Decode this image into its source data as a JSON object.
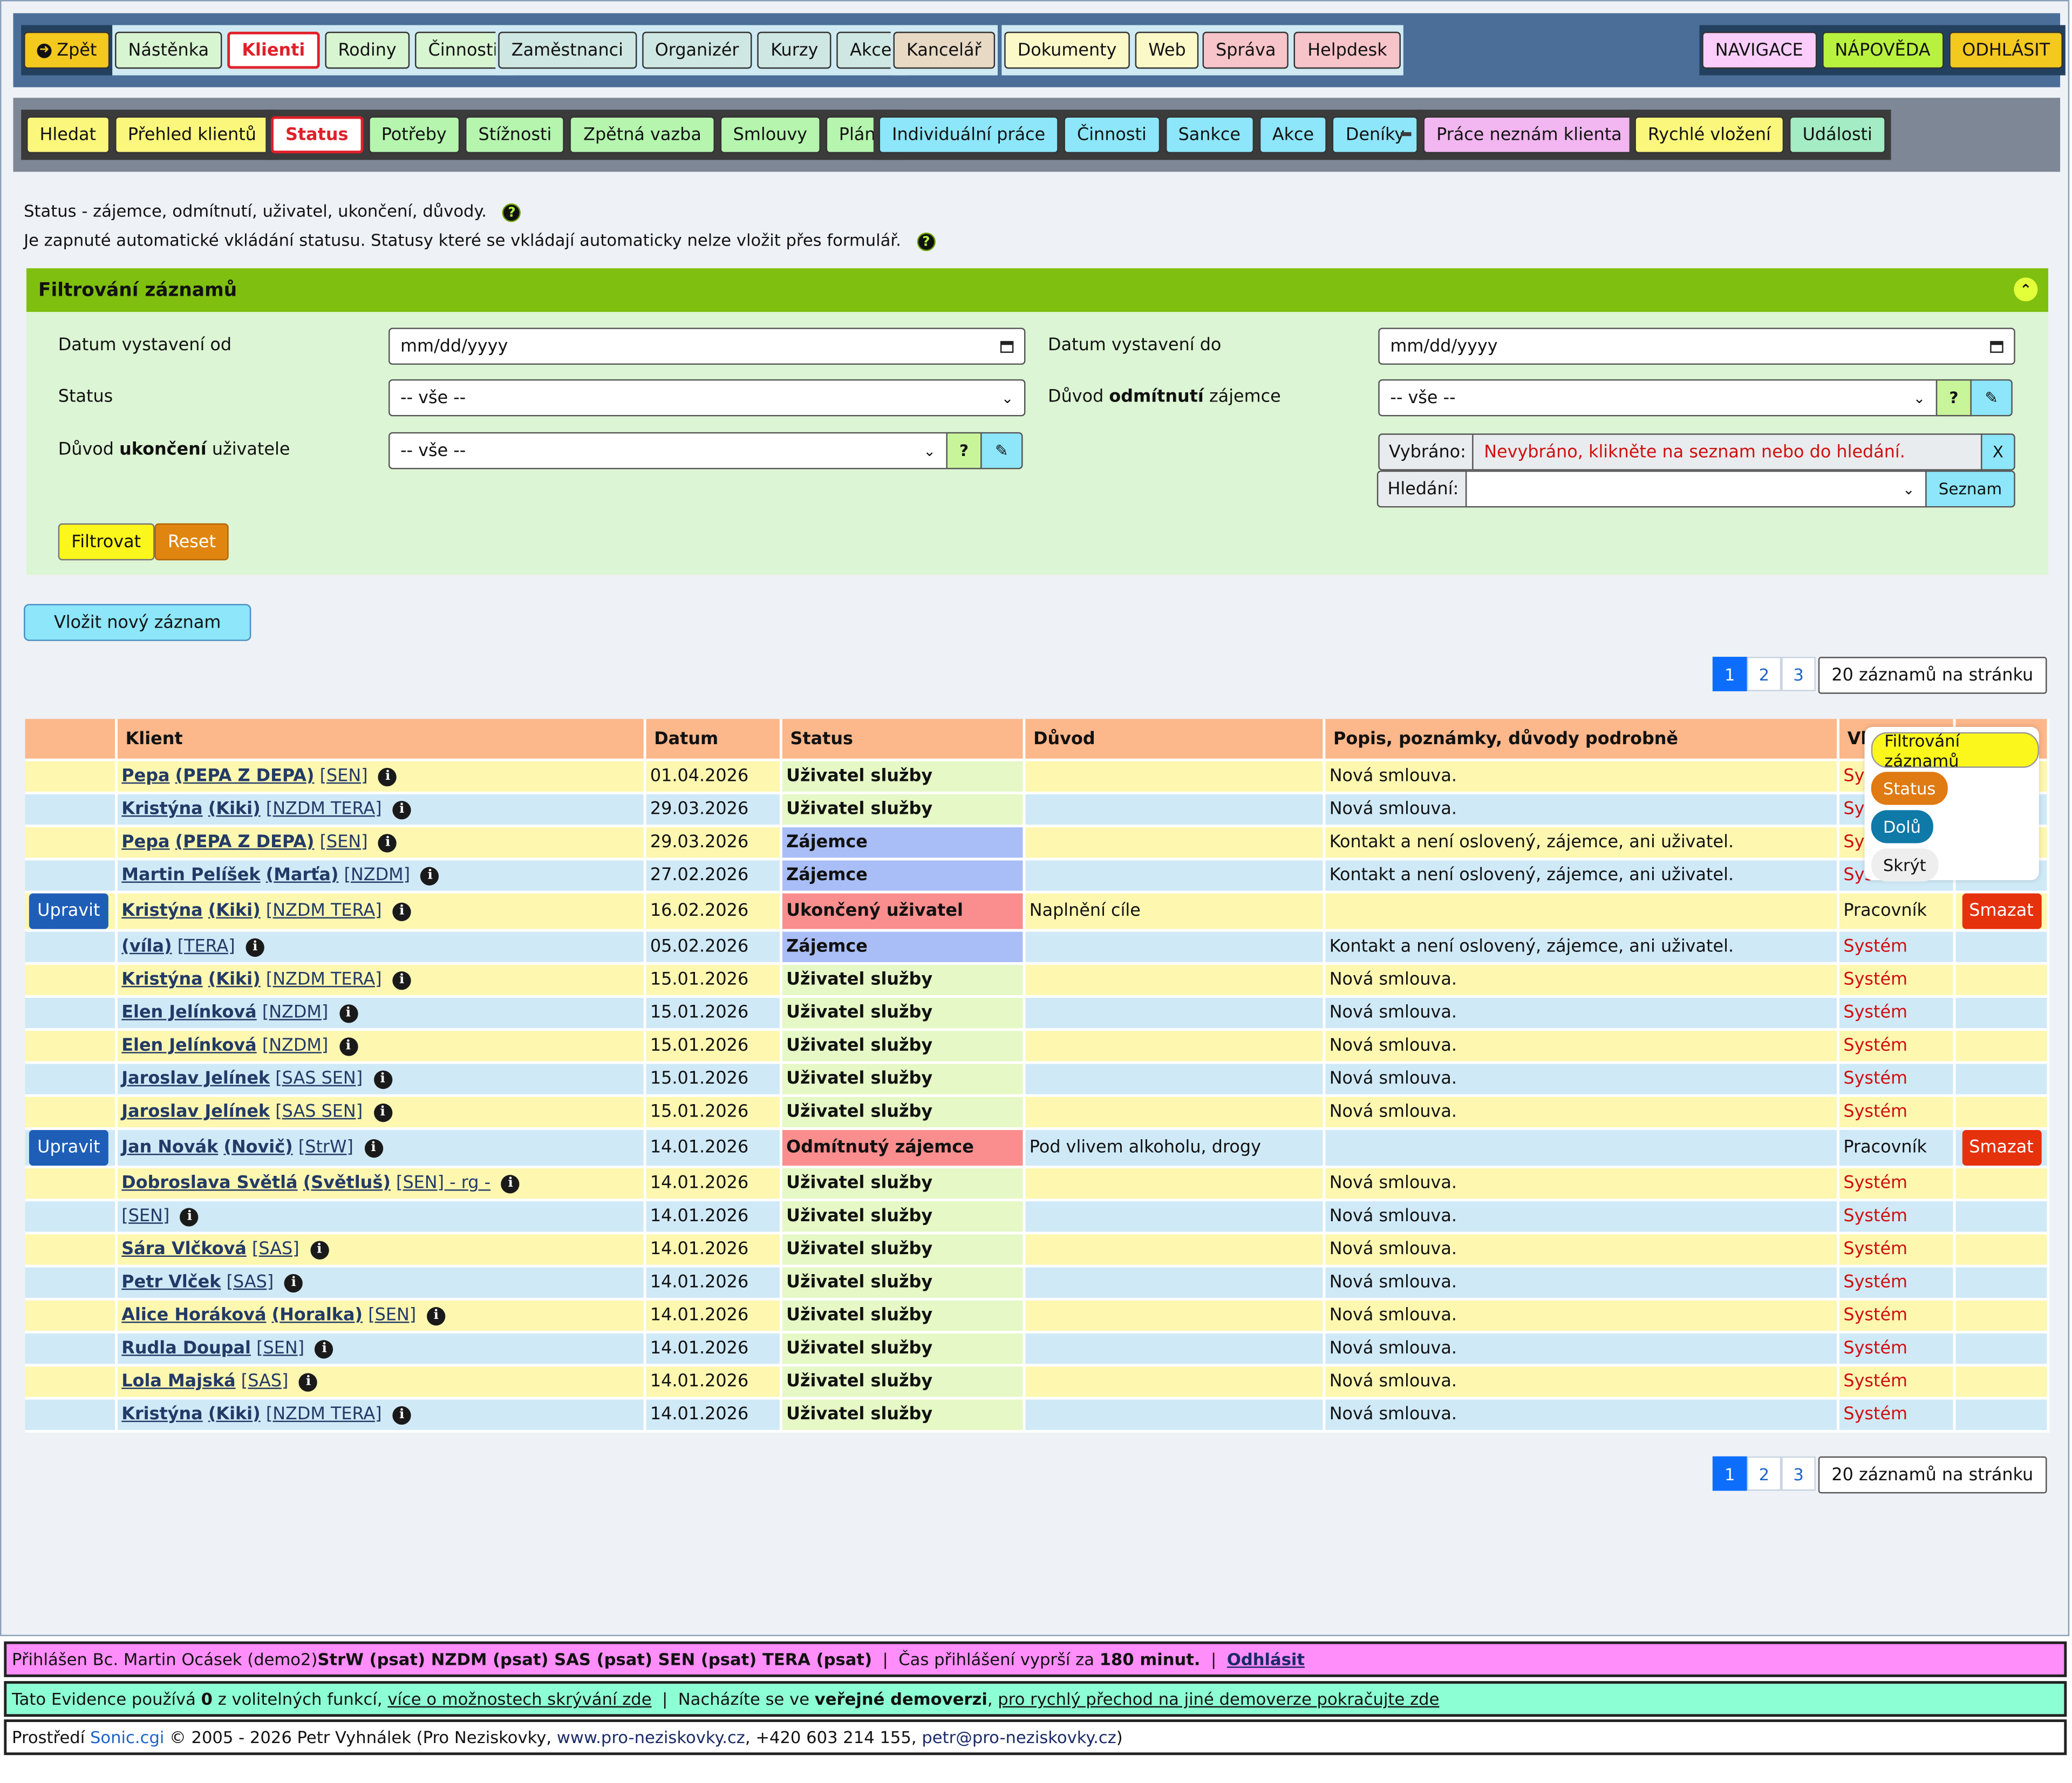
{
  "topnav": {
    "back": "Zpět",
    "items": [
      "Nástěnka",
      "Klienti",
      "Rodiny",
      "Činnosti",
      "Zaměstnanci",
      "Organizér",
      "Kurzy",
      "Akce",
      "Kancelář",
      "Dokumenty",
      "Web",
      "Správa",
      "Helpdesk"
    ],
    "right": [
      "NAVIGACE",
      "NÁPOVĚDA",
      "ODHLÁSIT"
    ]
  },
  "subnav": {
    "items": [
      "Hledat",
      "Přehled klientů",
      "Status",
      "Potřeby",
      "Stížnosti",
      "Zpětná vazba",
      "Smlouvy",
      "Plány",
      "Individuální práce",
      "Činnosti",
      "Sankce",
      "Akce",
      "Deníky",
      "Práce neznám klienta",
      "Rychlé vložení",
      "Události"
    ]
  },
  "intro": {
    "line1": "Status - zájemce, odmítnutí, uživatel, ukončení, důvody.",
    "line2": "Je zapnuté automatické vkládání statusu. Statusy které se vkládají automaticky nelze vložit přes formulář."
  },
  "filter": {
    "title": "Filtrování záznamů",
    "date_from_label": "Datum vystavení od",
    "date_to_label": "Datum vystavení do",
    "date_placeholder": "mm/dd/yyyy",
    "status_label": "Status",
    "reason_reject_pre": "Důvod ",
    "reason_reject_bold": "odmítnutí",
    "reason_reject_post": " zájemce",
    "reason_end_pre": "Důvod ",
    "reason_end_bold": "ukončení",
    "reason_end_post": " uživatele",
    "select_all": "-- vše --",
    "selected_label": "Vybráno:",
    "selected_value": "Nevybráno, klikněte na seznam nebo do hledání.",
    "search_label": "Hledání:",
    "list_button": "Seznam",
    "clear_button": "X",
    "question": "?",
    "filter_button": "Filtrovat",
    "reset_button": "Reset"
  },
  "new_record_button": "Vložit nový záznam",
  "pager": {
    "pages": [
      "1",
      "2",
      "3"
    ],
    "per_page": "20 záznamů na stránku"
  },
  "table": {
    "headers": [
      "",
      "Klient",
      "Datum",
      "Status",
      "Důvod",
      "Popis, poznámky, důvody podrobně",
      "Vl",
      ""
    ],
    "upravit": "Upravit",
    "smazat": "Smazat",
    "rows": [
      {
        "name": "Pepa",
        "nick": "PEPA Z DEPA",
        "tag": "[SEN]",
        "date": "01.04.2026",
        "status": "Uživatel služby",
        "st": "user",
        "reason": "",
        "desc": "Nová smlouva.",
        "by": "Sys",
        "act": false
      },
      {
        "name": "Kristýna",
        "nick": "Kiki",
        "tag": "[NZDM TERA]",
        "date": "29.03.2026",
        "status": "Uživatel služby",
        "st": "user",
        "reason": "",
        "desc": "Nová smlouva.",
        "by": "Sys",
        "act": false
      },
      {
        "name": "Pepa",
        "nick": "PEPA Z DEPA",
        "tag": "[SEN]",
        "date": "29.03.2026",
        "status": "Zájemce",
        "st": "zaj",
        "reason": "",
        "desc": "Kontakt a není oslovený, zájemce, ani uživatel.",
        "by": "Sys",
        "act": false
      },
      {
        "name": "Martin Pelíšek",
        "nick": "Marťa",
        "tag": "[NZDM]",
        "date": "27.02.2026",
        "status": "Zájemce",
        "st": "zaj",
        "reason": "",
        "desc": "Kontakt a není oslovený, zájemce, ani uživatel.",
        "by": "Sys",
        "act": false
      },
      {
        "name": "Kristýna",
        "nick": "Kiki",
        "tag": "[NZDM TERA]",
        "date": "16.02.2026",
        "status": "Ukončený uživatel",
        "st": "red",
        "reason": "Naplnění cíle",
        "desc": "",
        "by": "Pracovník",
        "act": true
      },
      {
        "name": "",
        "nick": "víla",
        "tag": "[TERA]",
        "date": "05.02.2026",
        "status": "Zájemce",
        "st": "zaj",
        "reason": "",
        "desc": "Kontakt a není oslovený, zájemce, ani uživatel.",
        "by": "Systém",
        "act": false
      },
      {
        "name": "Kristýna",
        "nick": "Kiki",
        "tag": "[NZDM TERA]",
        "date": "15.01.2026",
        "status": "Uživatel služby",
        "st": "user",
        "reason": "",
        "desc": "Nová smlouva.",
        "by": "Systém",
        "act": false
      },
      {
        "name": "Elen Jelínková",
        "nick": "",
        "tag": "[NZDM]",
        "date": "15.01.2026",
        "status": "Uživatel služby",
        "st": "user",
        "reason": "",
        "desc": "Nová smlouva.",
        "by": "Systém",
        "act": false
      },
      {
        "name": "Elen Jelínková",
        "nick": "",
        "tag": "[NZDM]",
        "date": "15.01.2026",
        "status": "Uživatel služby",
        "st": "user",
        "reason": "",
        "desc": "Nová smlouva.",
        "by": "Systém",
        "act": false
      },
      {
        "name": "Jaroslav Jelínek",
        "nick": "",
        "tag": "[SAS SEN]",
        "date": "15.01.2026",
        "status": "Uživatel služby",
        "st": "user",
        "reason": "",
        "desc": "Nová smlouva.",
        "by": "Systém",
        "act": false
      },
      {
        "name": "Jaroslav Jelínek",
        "nick": "",
        "tag": "[SAS SEN]",
        "date": "15.01.2026",
        "status": "Uživatel služby",
        "st": "user",
        "reason": "",
        "desc": "Nová smlouva.",
        "by": "Systém",
        "act": false
      },
      {
        "name": "Jan Novák",
        "nick": "Novič",
        "tag": "[StrW]",
        "date": "14.01.2026",
        "status": "Odmítnutý zájemce",
        "st": "red",
        "reason": "Pod vlivem alkoholu, drogy",
        "desc": "",
        "by": "Pracovník",
        "act": true
      },
      {
        "name": "Dobroslava Světlá",
        "nick": "Světluš",
        "tag": "[SEN] - rg -",
        "date": "14.01.2026",
        "status": "Uživatel služby",
        "st": "user",
        "reason": "",
        "desc": "Nová smlouva.",
        "by": "Systém",
        "act": false
      },
      {
        "name": "",
        "nick": "",
        "tag": "[SEN]",
        "date": "14.01.2026",
        "status": "Uživatel služby",
        "st": "user",
        "reason": "",
        "desc": "Nová smlouva.",
        "by": "Systém",
        "act": false
      },
      {
        "name": "Sára Vlčková",
        "nick": "",
        "tag": "[SAS]",
        "date": "14.01.2026",
        "status": "Uživatel služby",
        "st": "user",
        "reason": "",
        "desc": "Nová smlouva.",
        "by": "Systém",
        "act": false
      },
      {
        "name": "Petr Vlček",
        "nick": "",
        "tag": "[SAS]",
        "date": "14.01.2026",
        "status": "Uživatel služby",
        "st": "user",
        "reason": "",
        "desc": "Nová smlouva.",
        "by": "Systém",
        "act": false
      },
      {
        "name": "Alice Horáková",
        "nick": "Horalka",
        "tag": "[SEN]",
        "date": "14.01.2026",
        "status": "Uživatel služby",
        "st": "user",
        "reason": "",
        "desc": "Nová smlouva.",
        "by": "Systém",
        "act": false
      },
      {
        "name": "Rudla Doupal",
        "nick": "",
        "tag": "[SEN]",
        "date": "14.01.2026",
        "status": "Uživatel služby",
        "st": "user",
        "reason": "",
        "desc": "Nová smlouva.",
        "by": "Systém",
        "act": false
      },
      {
        "name": "Lola Majská",
        "nick": "",
        "tag": "[SAS]",
        "date": "14.01.2026",
        "status": "Uživatel služby",
        "st": "user",
        "reason": "",
        "desc": "Nová smlouva.",
        "by": "Systém",
        "act": false
      },
      {
        "name": "Kristýna",
        "nick": "Kiki",
        "tag": "[NZDM TERA]",
        "date": "14.01.2026",
        "status": "Uživatel služby",
        "st": "user",
        "reason": "",
        "desc": "Nová smlouva.",
        "by": "Systém",
        "act": false
      }
    ]
  },
  "floatmenu": [
    "Filtrování záznamů",
    "Status",
    "Dolů",
    "Skrýt"
  ],
  "footer": {
    "login_pre": "Přihlášen Bc. Martin Ocásek (demo2) ",
    "login_groups": "StrW (psat) NZDM (psat) SAS (psat) SEN (psat) TERA (psat)",
    "login_timeout_pre": "  |  Čas přihlášení vyprší za ",
    "login_timeout": "180 minut.",
    "login_sep": "  |  ",
    "logout": "Odhlásit",
    "ev_pre": "Tato Evidence používá ",
    "ev_count": "0",
    "ev_mid": " z volitelných funkcí, ",
    "ev_link": "více o možnostech skrývání zde",
    "ev_sep": "  |  Nacházíte se ve ",
    "ev_public": "veřejné demoverzi",
    "ev_comma": ", ",
    "ev_link2": "pro rychlý přechod na jiné demoverze pokračujte zde",
    "env_pre": "Prostředí ",
    "env_sonic": "Sonic.cgi",
    "env_mid": " © 2005 - 2026 Petr Vyhnálek (Pro Neziskovky, ",
    "env_web": "www.pro-neziskovky.cz",
    "env_phone": ", +420 603 214 155, ",
    "env_mail": "petr@pro-neziskovky.cz",
    "env_end": ")"
  },
  "colors": {
    "topnav_bg": "#4a6e98",
    "filter_header": "#7fbf0f",
    "table_header": "#fcb78a",
    "row_yellow": "#fdf7b0",
    "row_blue": "#cfe9f7",
    "status_user": "#e5f8c5",
    "status_zajemce": "#a9bef7",
    "status_red": "#fa8d8d",
    "login_bar": "#ff8dfa",
    "evidence_bar": "#8dffd4"
  }
}
